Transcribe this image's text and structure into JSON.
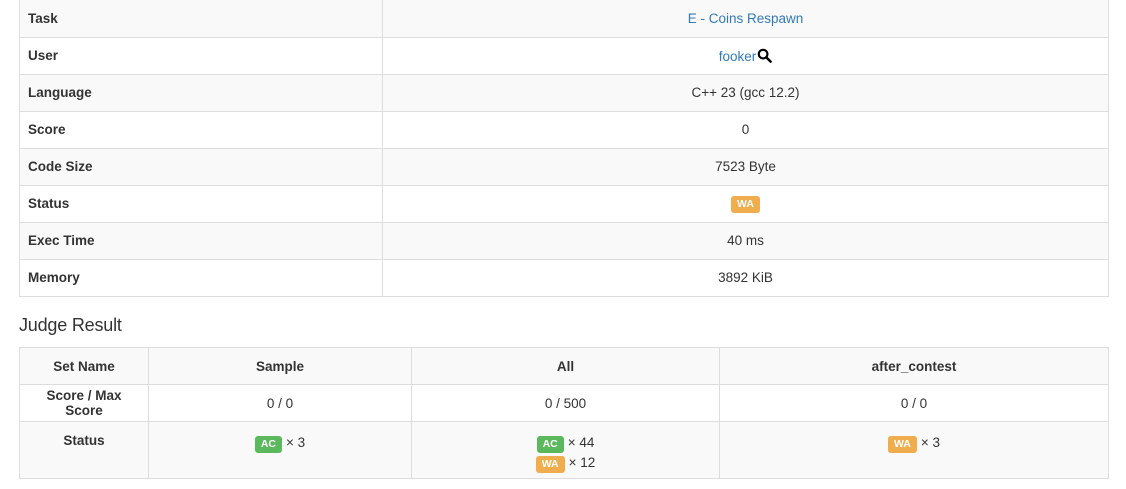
{
  "submission": {
    "rows": [
      {
        "label": "Task",
        "value": "E - Coins Respawn"
      },
      {
        "label": "User",
        "value": "fooker"
      },
      {
        "label": "Language",
        "value": "C++ 23 (gcc 12.2)"
      },
      {
        "label": "Score",
        "value": "0"
      },
      {
        "label": "Code Size",
        "value": "7523 Byte"
      },
      {
        "label": "Status",
        "value": "WA"
      },
      {
        "label": "Exec Time",
        "value": "40 ms"
      },
      {
        "label": "Memory",
        "value": "3892 KiB"
      }
    ]
  },
  "judge": {
    "heading": "Judge Result",
    "headers": [
      "Set Name",
      "Sample",
      "All",
      "after_contest"
    ],
    "score_row": {
      "label": "Score / Max Score",
      "values": [
        "0 / 0",
        "0 / 500",
        "0 / 0"
      ]
    },
    "status_row": {
      "label": "Status",
      "sample": [
        {
          "badge": "AC",
          "count": "× 3"
        }
      ],
      "all": [
        {
          "badge": "AC",
          "count": "× 44"
        },
        {
          "badge": "WA",
          "count": "× 12"
        }
      ],
      "after_contest": [
        {
          "badge": "WA",
          "count": "× 3"
        }
      ]
    }
  },
  "colors": {
    "link": "#337ab7",
    "ac": "#5cb85c",
    "wa": "#f0ad4e",
    "border": "#dddddd",
    "stripe": "#f9f9f9"
  },
  "icons": {
    "user_search": "search-icon"
  }
}
